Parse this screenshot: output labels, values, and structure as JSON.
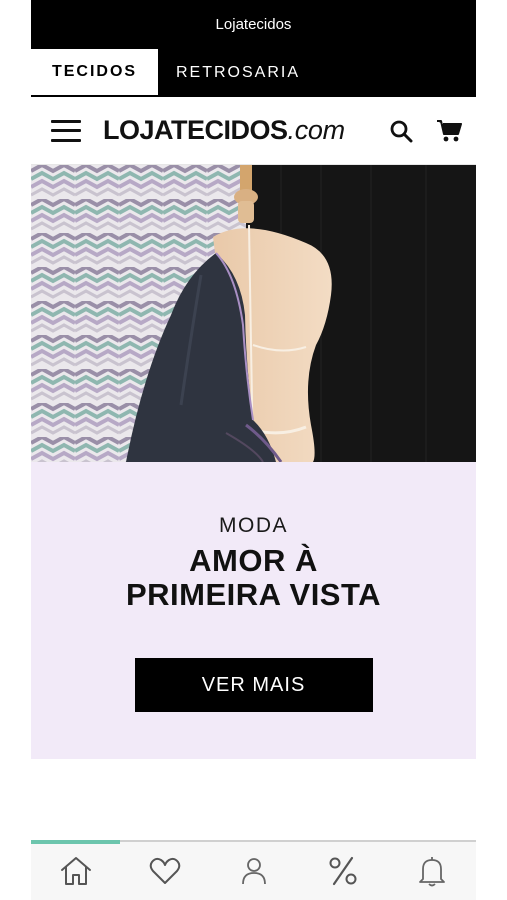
{
  "status_bar": {
    "title": "Lojatecidos"
  },
  "tabs": [
    {
      "label": "TECIDOS",
      "active": true
    },
    {
      "label": "RETROSARIA",
      "active": false
    }
  ],
  "header": {
    "logo_main": "LOJATECIDOS",
    "logo_ext": ".com",
    "icons": [
      "menu-icon",
      "search-icon",
      "cart-icon"
    ]
  },
  "promo": {
    "kicker": "MODA",
    "title": "AMOR À\nPRIMEIRA VISTA",
    "button_label": "VER MAIS",
    "background_color": "#f2eaf8"
  },
  "bottom_nav": {
    "items": [
      "home-icon",
      "heart-icon",
      "user-icon",
      "percent-icon",
      "bell-icon"
    ],
    "active_index": 0,
    "accent_color": "#6cc5ad"
  }
}
